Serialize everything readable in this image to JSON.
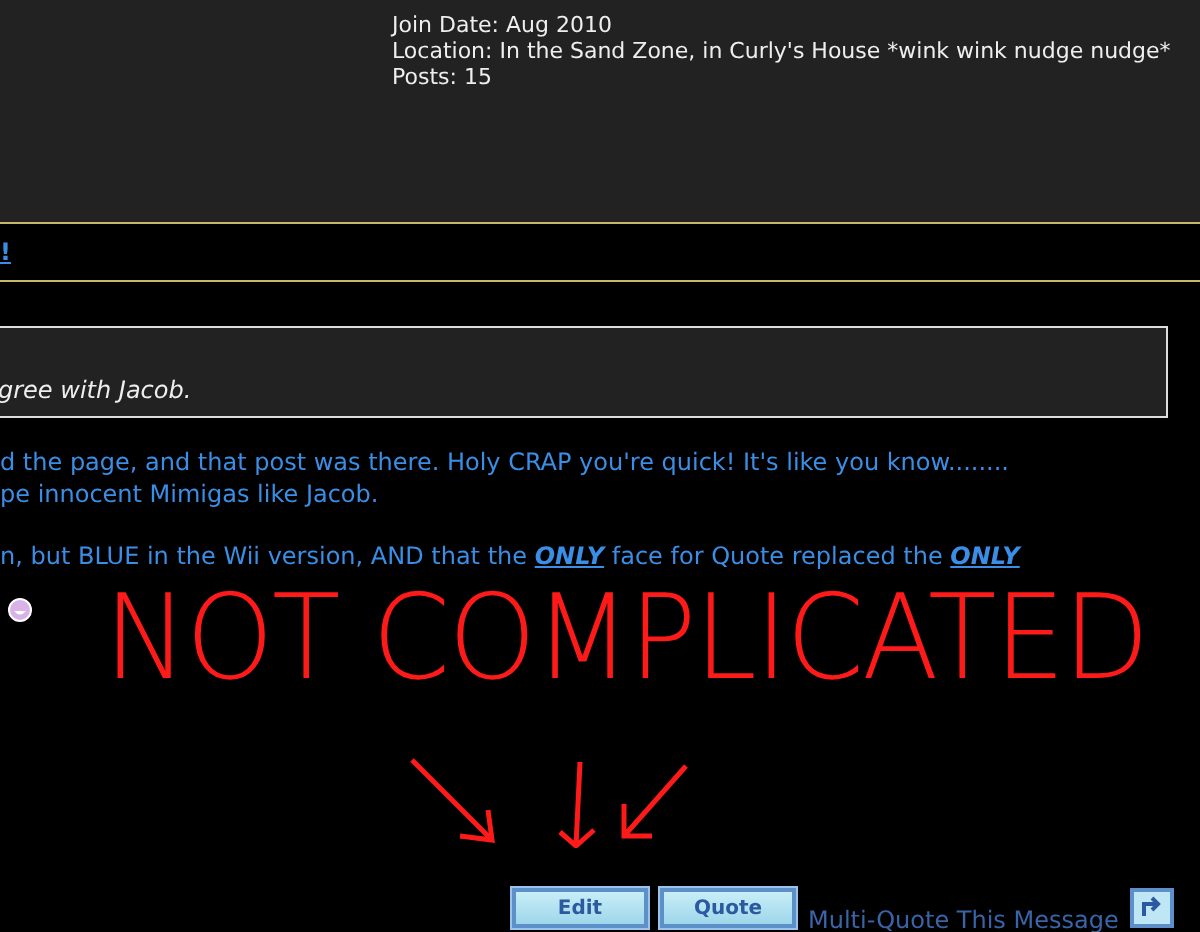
{
  "user_info": [
    "Join Date: Aug 2010",
    "Location: In the Sand Zone, in Curly's House *wink wink nudge nudge*",
    "Posts: 15"
  ],
  "link_fragment": "!",
  "quote": {
    "text": "gree with Jacob."
  },
  "post_paragraphs": [
    [
      "d the page, and that post was there. Holy CRAP you're quick! It's like you know........",
      "pe innocent Mimigas like Jacob."
    ],
    [
      "n, but BLUE in the Wii version, AND that the **ONLY** face for Quote replaced the **ONLY**"
    ]
  ],
  "annotation": {
    "text": "NOT COMPLICATED",
    "color": "#ff1a1a"
  },
  "buttons": [
    "Edit",
    "Quote"
  ],
  "multi_quote": {
    "label": "Multi-Quote This Message"
  }
}
